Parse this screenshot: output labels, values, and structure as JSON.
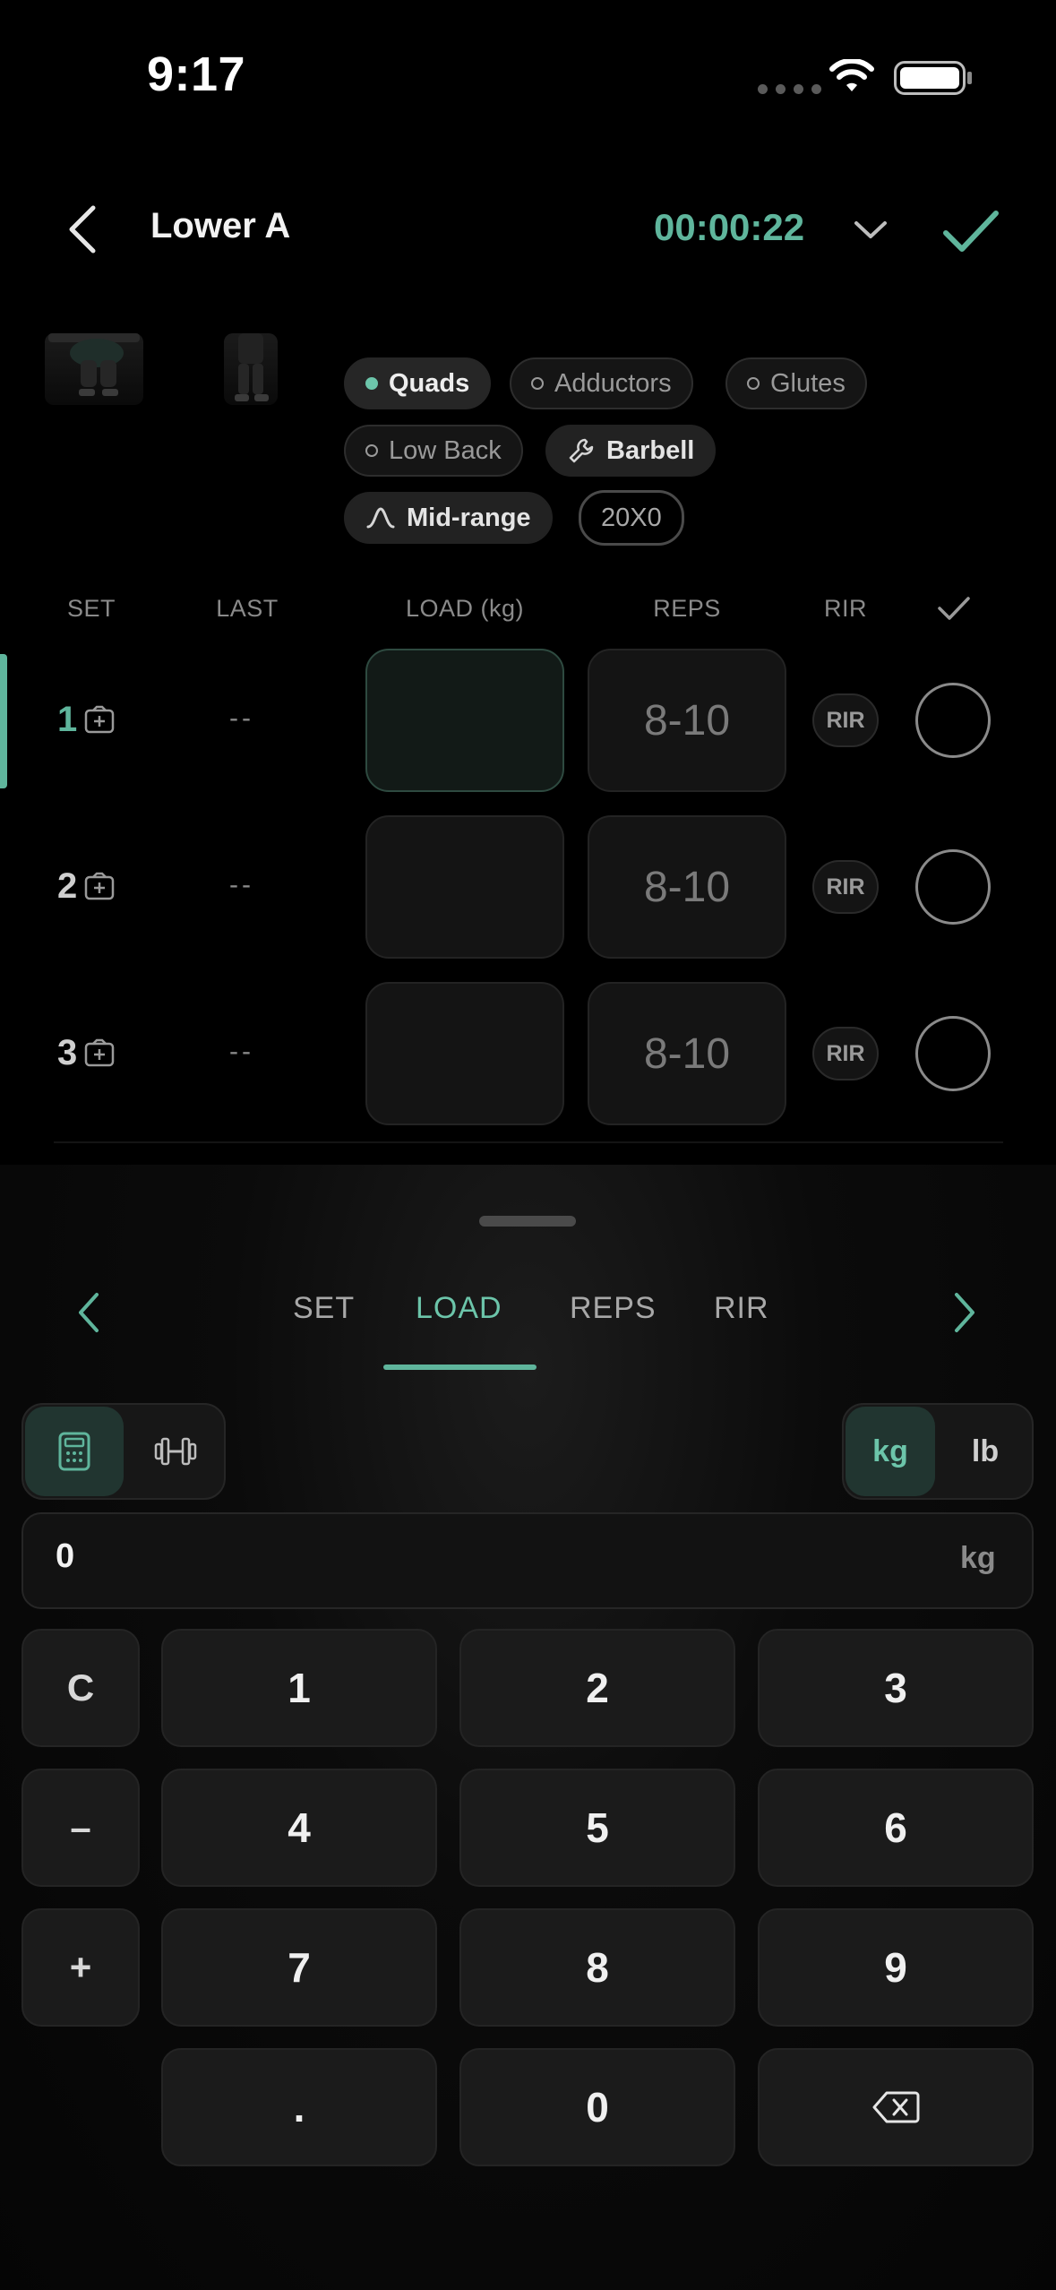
{
  "status_bar": {
    "time": "9:17"
  },
  "header": {
    "title": "Lower A",
    "timer": "00:00:22"
  },
  "exercise": {
    "tags": {
      "quads": "Quads",
      "adductors": "Adductors",
      "glutes": "Glutes",
      "low_back": "Low Back",
      "barbell": "Barbell",
      "mid_range": "Mid-range",
      "tempo": "20X0"
    }
  },
  "table": {
    "headers": {
      "set": "SET",
      "last": "LAST",
      "load": "LOAD (kg)",
      "reps": "REPS",
      "rir": "RIR"
    },
    "rows": [
      {
        "set": "1",
        "last": "--",
        "load": "",
        "reps": "8-10",
        "rir": "RIR"
      },
      {
        "set": "2",
        "last": "--",
        "load": "",
        "reps": "8-10",
        "rir": "RIR"
      },
      {
        "set": "3",
        "last": "--",
        "load": "",
        "reps": "8-10",
        "rir": "RIR"
      }
    ]
  },
  "keyboard": {
    "tabs": {
      "set": "SET",
      "load": "LOAD",
      "reps": "REPS",
      "rir": "RIR"
    },
    "active_tab": "LOAD",
    "units": {
      "kg": "kg",
      "lb": "lb"
    },
    "selected_unit": "kg",
    "entry": {
      "value": "0",
      "unit": "kg"
    },
    "keys": {
      "clear": "C",
      "minus": "–",
      "plus": "+",
      "k1": "1",
      "k2": "2",
      "k3": "3",
      "k4": "4",
      "k5": "5",
      "k6": "6",
      "k7": "7",
      "k8": "8",
      "k9": "9",
      "dot": ".",
      "k0": "0"
    }
  },
  "colors": {
    "accent": "#5fb59c",
    "background": "#000000"
  }
}
